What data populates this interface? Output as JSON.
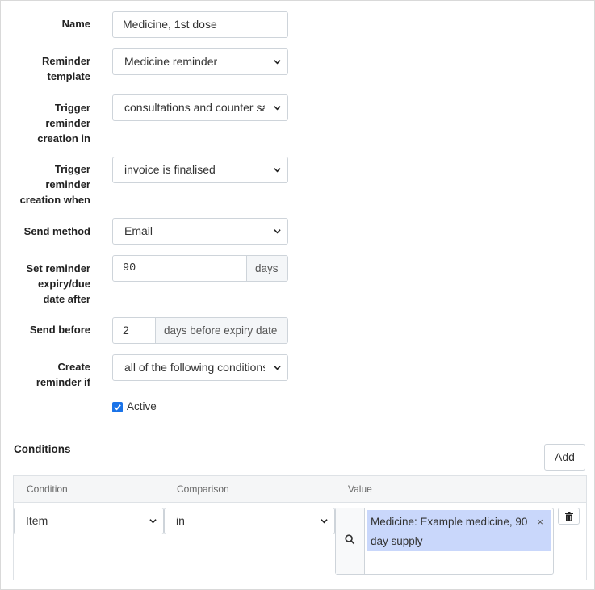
{
  "form": {
    "name": {
      "label": "Name",
      "value": "Medicine, 1st dose"
    },
    "reminder_template": {
      "label_line1": "Reminder",
      "label_line2": "template",
      "value": "Medicine reminder"
    },
    "trigger_in": {
      "label_line1": "Trigger",
      "label_line2": "reminder",
      "label_line3": "creation in",
      "value": "consultations and counter sales"
    },
    "trigger_when": {
      "label_line1": "Trigger",
      "label_line2": "reminder",
      "label_line3": "creation when",
      "value": "invoice is finalised"
    },
    "send_method": {
      "label": "Send method",
      "value": "Email"
    },
    "expiry": {
      "label_line1": "Set reminder",
      "label_line2": "expiry/due",
      "label_line3": "date after",
      "value": "90",
      "addon": "days"
    },
    "send_before": {
      "label": "Send before",
      "value": "2",
      "addon": "days before expiry date"
    },
    "create_if": {
      "label_line1": "Create",
      "label_line2": "reminder if",
      "value": "all of the following conditions"
    },
    "active": {
      "label": "Active",
      "checked": true
    }
  },
  "conditions": {
    "title": "Conditions",
    "add_label": "Add",
    "headers": {
      "condition": "Condition",
      "comparison": "Comparison",
      "value": "Value"
    },
    "rows": [
      {
        "condition": "Item",
        "comparison": "in",
        "value_line1": "Medicine: Example medicine, 90",
        "value_line2": "day supply",
        "remove_glyph": "×"
      }
    ]
  },
  "colors": {
    "accent": "#1a73e8",
    "chip": "#c9d7fb"
  },
  "icons": [
    "chevron-down-icon",
    "check-icon",
    "search-icon",
    "trash-icon"
  ]
}
